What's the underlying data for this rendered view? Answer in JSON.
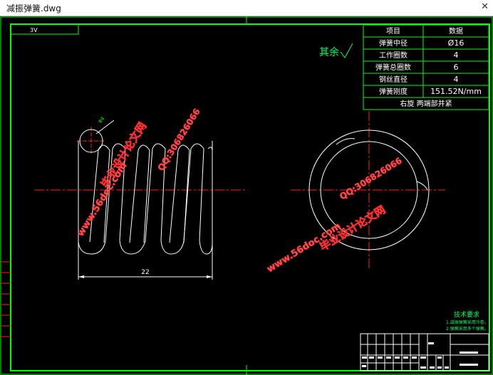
{
  "window": {
    "title": "减振弹簧.dwg",
    "close_glyph": "✕"
  },
  "drawing": {
    "corner_label": "3V",
    "roughness_note": "其余",
    "dimension_width": "22",
    "wire_dim": "φ4",
    "spec_table": {
      "headers": [
        "项目",
        "数据"
      ],
      "rows": [
        [
          "弹簧中径",
          "Ø16"
        ],
        [
          "工作圈数",
          "4"
        ],
        [
          "弹簧总圈数",
          "6"
        ],
        [
          "钢丝直径",
          "4"
        ],
        [
          "弹簧刚度",
          "151.52N/mm"
        ]
      ],
      "footer": "右旋  两端部并紧"
    },
    "tech_req": {
      "title": "技术要求",
      "lines": [
        "1.减振弹簧采用冷卷。",
        "2.弹簧采用多个弹簧。"
      ]
    },
    "watermarks": [
      "毕业设计论文网",
      "www.56doc.com",
      "QQ:306826066"
    ]
  },
  "colors": {
    "frame": "#00ff00",
    "center": "#ff2020",
    "geometry": "#ffffff",
    "watermark": "#ff3030",
    "table": "#00ff00",
    "note": "#00ff66"
  }
}
